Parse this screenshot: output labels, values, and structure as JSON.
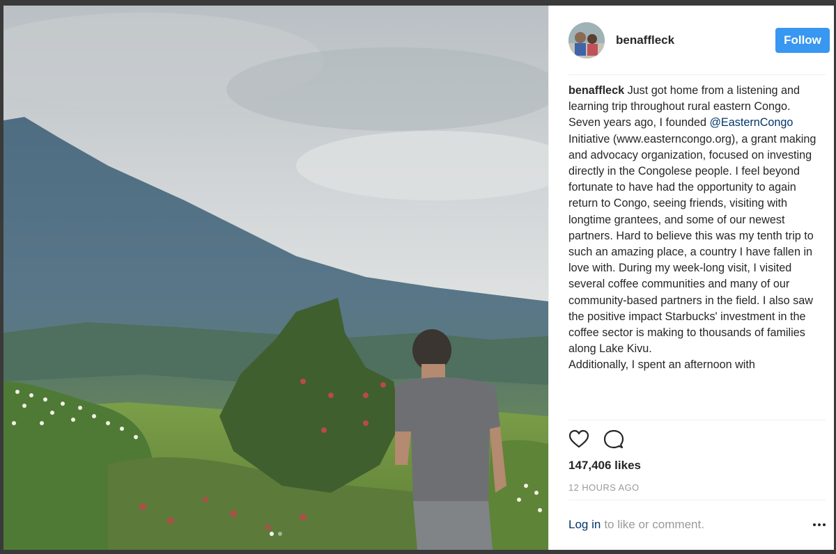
{
  "post": {
    "username": "benaffleck",
    "follow_label": "Follow",
    "caption_user": "benaffleck",
    "caption_part1": "Just got home from a listening and learning trip throughout rural eastern Congo. Seven years ago, I founded ",
    "caption_mention": "@EasternCongo",
    "caption_part2": " Initiative (www.easterncongo.org), a grant making and advocacy organization, focused on investing directly in the Congolese people. I feel beyond fortunate to have had the opportunity to again return to Congo, seeing friends, visiting with longtime grantees, and some of our newest partners. Hard to believe this was my tenth trip to such an amazing place, a country I have fallen in love with. During my week-long visit, I visited several coffee communities and many of our community-based partners in the field. I also saw the positive impact Starbucks' investment in the coffee sector is making to thousands of families along Lake Kivu.",
    "caption_part3": "Additionally, I spent an afternoon with",
    "likes": "147,406 likes",
    "timestamp": "12 HOURS AGO",
    "login_link": "Log in",
    "login_rest": "to like or comment."
  },
  "carousel": {
    "count": 2,
    "active_index": 0
  },
  "icons": {
    "like": "heart-icon",
    "comment": "comment-icon",
    "more": "more-options-icon"
  },
  "colors": {
    "follow_button": "#3897f0",
    "link": "#003569",
    "text": "#262626",
    "muted": "#999999"
  }
}
